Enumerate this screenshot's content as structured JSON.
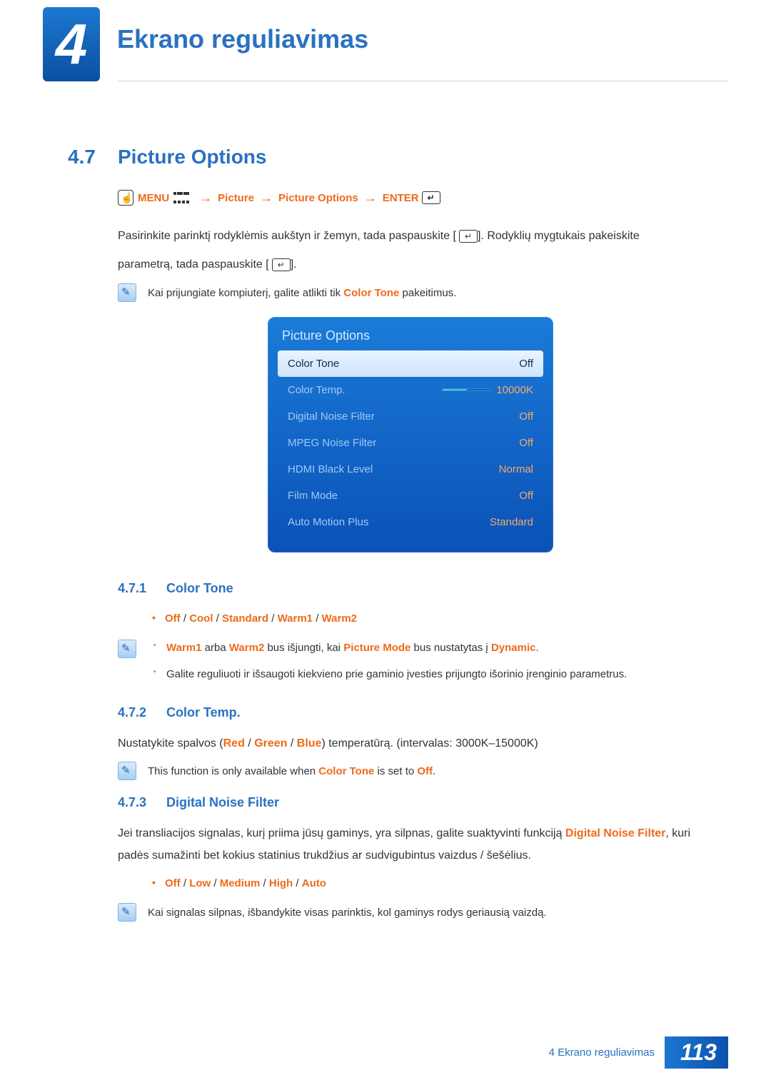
{
  "chapter": {
    "number": "4",
    "title": "Ekrano reguliavimas"
  },
  "section": {
    "number": "4.7",
    "title": "Picture Options"
  },
  "breadcrumb": {
    "menu": "MENU",
    "p1": "Picture",
    "p2": "Picture Options",
    "enter": "ENTER"
  },
  "intro": {
    "line1_a": "Pasirinkite parinktį rodyklėmis aukštyn ir žemyn, tada paspauskite [",
    "line1_b": "]. Rodyklių mygtukais pakeiskite",
    "line2_a": "parametrą, tada paspauskite [",
    "line2_b": "]."
  },
  "note1": {
    "pre": "Kai prijungiate kompiuterį, galite atlikti tik ",
    "hl": "Color Tone",
    "post": " pakeitimus."
  },
  "osd": {
    "title": "Picture Options",
    "rows": [
      {
        "label": "Color Tone",
        "value": "Off",
        "selected": true,
        "slider": false
      },
      {
        "label": "Color Temp.",
        "value": "10000K",
        "selected": false,
        "slider": true
      },
      {
        "label": "Digital Noise Filter",
        "value": "Off",
        "selected": false,
        "slider": false
      },
      {
        "label": "MPEG Noise Filter",
        "value": "Off",
        "selected": false,
        "slider": false
      },
      {
        "label": "HDMI Black Level",
        "value": "Normal",
        "selected": false,
        "slider": false
      },
      {
        "label": "Film Mode",
        "value": "Off",
        "selected": false,
        "slider": false
      },
      {
        "label": "Auto Motion Plus",
        "value": "Standard",
        "selected": false,
        "slider": false
      }
    ]
  },
  "s471": {
    "num": "4.7.1",
    "title": "Color Tone",
    "opts": [
      "Off",
      "Cool",
      "Standard",
      "Warm1",
      "Warm2"
    ],
    "note_b1_pre": "",
    "note_b1_w1": "Warm1",
    "note_b1_mid1": " arba ",
    "note_b1_w2": "Warm2",
    "note_b1_mid2": " bus išjungti, kai ",
    "note_b1_pm": "Picture Mode",
    "note_b1_mid3": " bus nustatytas į ",
    "note_b1_dyn": "Dynamic",
    "note_b1_post": ".",
    "note_b2": "Galite reguliuoti ir išsaugoti kiekvieno prie gaminio įvesties prijungto išorinio įrenginio parametrus."
  },
  "s472": {
    "num": "4.7.2",
    "title": "Color Temp.",
    "body_pre": "Nustatykite spalvos (",
    "r": "Red",
    "sep1": " / ",
    "g": "Green",
    "sep2": " / ",
    "b": "Blue",
    "body_post": ") temperatūrą. (intervalas: 3000K–15000K)",
    "note_pre": "This function is only available when ",
    "note_hl": "Color Tone",
    "note_mid": " is set to ",
    "note_off": "Off",
    "note_post": "."
  },
  "s473": {
    "num": "4.7.3",
    "title": "Digital Noise Filter",
    "body_pre": "Jei transliacijos signalas, kurį priima jūsų gaminys, yra silpnas, galite suaktyvinti funkciją ",
    "body_hl": "Digital Noise Filter",
    "body_post": ", kuri padės sumažinti bet kokius statinius trukdžius ar sudvigubintus vaizdus / šešėlius.",
    "opts": [
      "Off",
      "Low",
      "Medium",
      "High",
      "Auto"
    ],
    "note": "Kai signalas silpnas, išbandykite visas parinktis, kol gaminys rodys geriausią vaizdą."
  },
  "footer": {
    "label": "4 Ekrano reguliavimas",
    "page": "113"
  }
}
